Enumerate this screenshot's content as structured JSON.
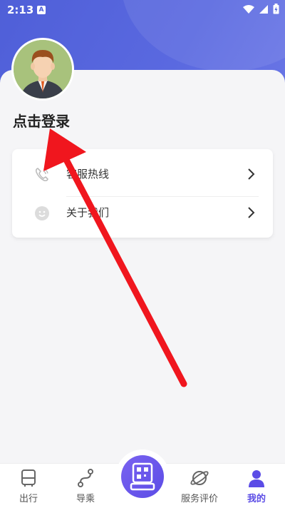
{
  "status_bar": {
    "time": "2:13",
    "a_badge": "A"
  },
  "profile": {
    "login_text": "点击登录"
  },
  "menu": {
    "items": [
      {
        "label": "客服热线",
        "icon": "phone-icon"
      },
      {
        "label": "关于我们",
        "icon": "smile-icon"
      }
    ]
  },
  "bottom_nav": {
    "items": [
      {
        "label": "出行",
        "icon": "bus-icon"
      },
      {
        "label": "导乘",
        "icon": "route-icon"
      },
      {
        "label": "服务评价",
        "icon": "planet-icon"
      },
      {
        "label": "我的",
        "icon": "user-icon"
      }
    ],
    "active_index": 3,
    "center_icon": "qr-scan-icon"
  },
  "colors": {
    "brand": "#4f5fd8",
    "active": "#5b4ce6",
    "annotation_arrow": "#f0161e"
  }
}
